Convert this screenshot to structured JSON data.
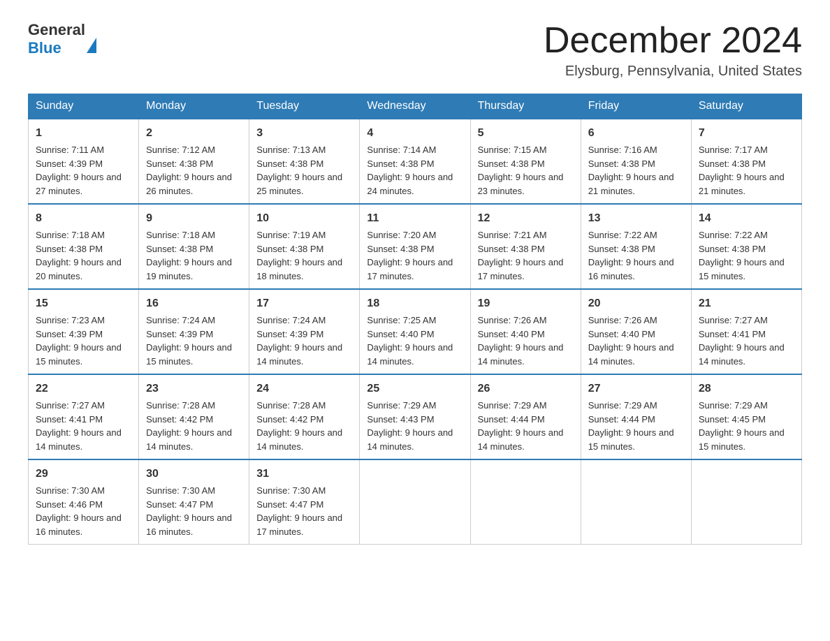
{
  "header": {
    "logo_general": "General",
    "logo_blue": "Blue",
    "month_title": "December 2024",
    "location": "Elysburg, Pennsylvania, United States"
  },
  "days_of_week": [
    "Sunday",
    "Monday",
    "Tuesday",
    "Wednesday",
    "Thursday",
    "Friday",
    "Saturday"
  ],
  "weeks": [
    [
      {
        "day": "1",
        "sunrise": "7:11 AM",
        "sunset": "4:39 PM",
        "daylight": "9 hours and 27 minutes."
      },
      {
        "day": "2",
        "sunrise": "7:12 AM",
        "sunset": "4:38 PM",
        "daylight": "9 hours and 26 minutes."
      },
      {
        "day": "3",
        "sunrise": "7:13 AM",
        "sunset": "4:38 PM",
        "daylight": "9 hours and 25 minutes."
      },
      {
        "day": "4",
        "sunrise": "7:14 AM",
        "sunset": "4:38 PM",
        "daylight": "9 hours and 24 minutes."
      },
      {
        "day": "5",
        "sunrise": "7:15 AM",
        "sunset": "4:38 PM",
        "daylight": "9 hours and 23 minutes."
      },
      {
        "day": "6",
        "sunrise": "7:16 AM",
        "sunset": "4:38 PM",
        "daylight": "9 hours and 21 minutes."
      },
      {
        "day": "7",
        "sunrise": "7:17 AM",
        "sunset": "4:38 PM",
        "daylight": "9 hours and 21 minutes."
      }
    ],
    [
      {
        "day": "8",
        "sunrise": "7:18 AM",
        "sunset": "4:38 PM",
        "daylight": "9 hours and 20 minutes."
      },
      {
        "day": "9",
        "sunrise": "7:18 AM",
        "sunset": "4:38 PM",
        "daylight": "9 hours and 19 minutes."
      },
      {
        "day": "10",
        "sunrise": "7:19 AM",
        "sunset": "4:38 PM",
        "daylight": "9 hours and 18 minutes."
      },
      {
        "day": "11",
        "sunrise": "7:20 AM",
        "sunset": "4:38 PM",
        "daylight": "9 hours and 17 minutes."
      },
      {
        "day": "12",
        "sunrise": "7:21 AM",
        "sunset": "4:38 PM",
        "daylight": "9 hours and 17 minutes."
      },
      {
        "day": "13",
        "sunrise": "7:22 AM",
        "sunset": "4:38 PM",
        "daylight": "9 hours and 16 minutes."
      },
      {
        "day": "14",
        "sunrise": "7:22 AM",
        "sunset": "4:38 PM",
        "daylight": "9 hours and 15 minutes."
      }
    ],
    [
      {
        "day": "15",
        "sunrise": "7:23 AM",
        "sunset": "4:39 PM",
        "daylight": "9 hours and 15 minutes."
      },
      {
        "day": "16",
        "sunrise": "7:24 AM",
        "sunset": "4:39 PM",
        "daylight": "9 hours and 15 minutes."
      },
      {
        "day": "17",
        "sunrise": "7:24 AM",
        "sunset": "4:39 PM",
        "daylight": "9 hours and 14 minutes."
      },
      {
        "day": "18",
        "sunrise": "7:25 AM",
        "sunset": "4:40 PM",
        "daylight": "9 hours and 14 minutes."
      },
      {
        "day": "19",
        "sunrise": "7:26 AM",
        "sunset": "4:40 PM",
        "daylight": "9 hours and 14 minutes."
      },
      {
        "day": "20",
        "sunrise": "7:26 AM",
        "sunset": "4:40 PM",
        "daylight": "9 hours and 14 minutes."
      },
      {
        "day": "21",
        "sunrise": "7:27 AM",
        "sunset": "4:41 PM",
        "daylight": "9 hours and 14 minutes."
      }
    ],
    [
      {
        "day": "22",
        "sunrise": "7:27 AM",
        "sunset": "4:41 PM",
        "daylight": "9 hours and 14 minutes."
      },
      {
        "day": "23",
        "sunrise": "7:28 AM",
        "sunset": "4:42 PM",
        "daylight": "9 hours and 14 minutes."
      },
      {
        "day": "24",
        "sunrise": "7:28 AM",
        "sunset": "4:42 PM",
        "daylight": "9 hours and 14 minutes."
      },
      {
        "day": "25",
        "sunrise": "7:29 AM",
        "sunset": "4:43 PM",
        "daylight": "9 hours and 14 minutes."
      },
      {
        "day": "26",
        "sunrise": "7:29 AM",
        "sunset": "4:44 PM",
        "daylight": "9 hours and 14 minutes."
      },
      {
        "day": "27",
        "sunrise": "7:29 AM",
        "sunset": "4:44 PM",
        "daylight": "9 hours and 15 minutes."
      },
      {
        "day": "28",
        "sunrise": "7:29 AM",
        "sunset": "4:45 PM",
        "daylight": "9 hours and 15 minutes."
      }
    ],
    [
      {
        "day": "29",
        "sunrise": "7:30 AM",
        "sunset": "4:46 PM",
        "daylight": "9 hours and 16 minutes."
      },
      {
        "day": "30",
        "sunrise": "7:30 AM",
        "sunset": "4:47 PM",
        "daylight": "9 hours and 16 minutes."
      },
      {
        "day": "31",
        "sunrise": "7:30 AM",
        "sunset": "4:47 PM",
        "daylight": "9 hours and 17 minutes."
      },
      null,
      null,
      null,
      null
    ]
  ]
}
